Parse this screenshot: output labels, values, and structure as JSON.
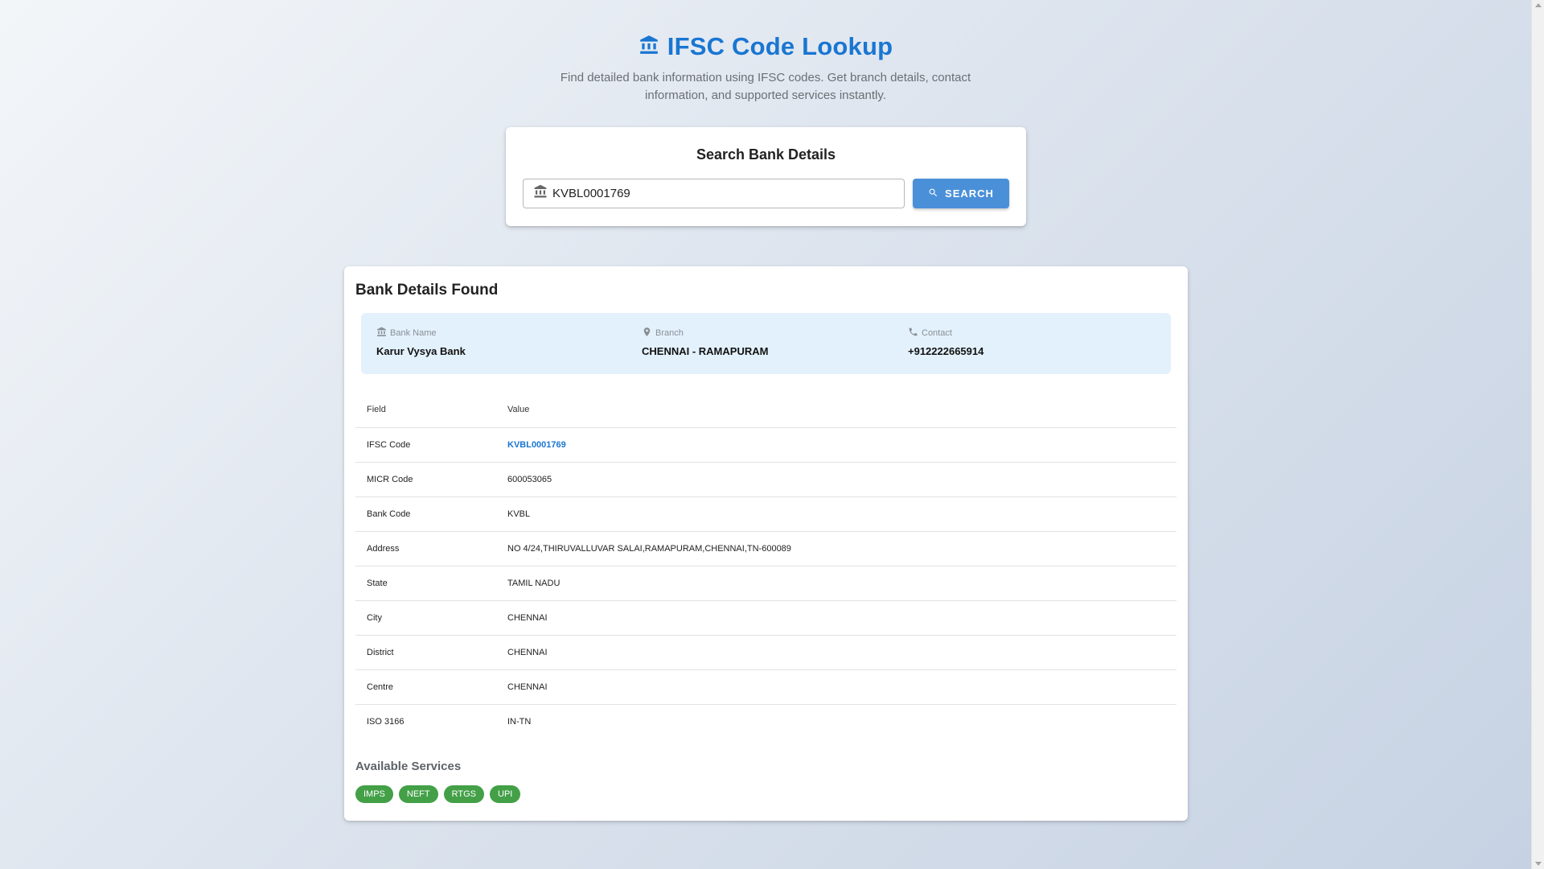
{
  "header": {
    "icon": "bank-icon",
    "title": "IFSC Code Lookup",
    "subtitle": "Find detailed bank information using IFSC codes. Get branch details, contact information, and supported services instantly."
  },
  "search": {
    "title": "Search Bank Details",
    "input_icon": "bank-icon",
    "value": "KVBL0001769",
    "button_icon": "search-icon",
    "button_label": "SEARCH"
  },
  "results": {
    "title": "Bank Details Found",
    "summary": [
      {
        "icon": "bank-icon",
        "label": "Bank Name",
        "value": "Karur Vysya Bank"
      },
      {
        "icon": "location-pin-icon",
        "label": "Branch",
        "value": "CHENNAI - RAMAPURAM"
      },
      {
        "icon": "phone-icon",
        "label": "Contact",
        "value": "+912222665914"
      }
    ],
    "table": {
      "headers": [
        "Field",
        "Value"
      ],
      "rows": [
        {
          "field": "IFSC Code",
          "value": "KVBL0001769"
        },
        {
          "field": "MICR Code",
          "value": "600053065"
        },
        {
          "field": "Bank Code",
          "value": "KVBL"
        },
        {
          "field": "Address",
          "value": "NO 4/24,THIRUVALLUVAR SALAI,RAMAPURAM,CHENNAI,TN-600089"
        },
        {
          "field": "State",
          "value": "TAMIL NADU"
        },
        {
          "field": "City",
          "value": "CHENNAI"
        },
        {
          "field": "District",
          "value": "CHENNAI"
        },
        {
          "field": "Centre",
          "value": "CHENNAI"
        },
        {
          "field": "ISO 3166",
          "value": "IN-TN"
        }
      ]
    },
    "services_title": "Available Services",
    "services": [
      "IMPS",
      "NEFT",
      "RTGS",
      "UPI"
    ]
  },
  "colors": {
    "primary": "#1976d2",
    "button": "#4a90d9",
    "chip": "#43a047",
    "summary_bg": "#e3f1fc"
  }
}
